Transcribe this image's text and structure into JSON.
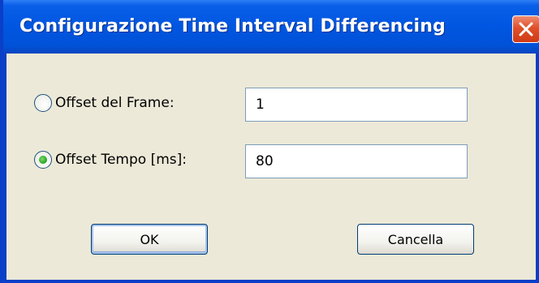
{
  "window": {
    "title": "Configurazione Time Interval Differencing"
  },
  "options": [
    {
      "label": "Offset del Frame:",
      "selected": false,
      "value": "1"
    },
    {
      "label": "Offset Tempo [ms]:",
      "selected": true,
      "value": "80"
    }
  ],
  "buttons": {
    "ok_label": "OK",
    "cancel_label": "Cancella"
  },
  "icons": {
    "close": "close-icon"
  },
  "colors": {
    "titlebar": "#0056e0",
    "client_bg": "#ece9d8",
    "close_button": "#e0502a",
    "radio_selected": "#21a121"
  }
}
